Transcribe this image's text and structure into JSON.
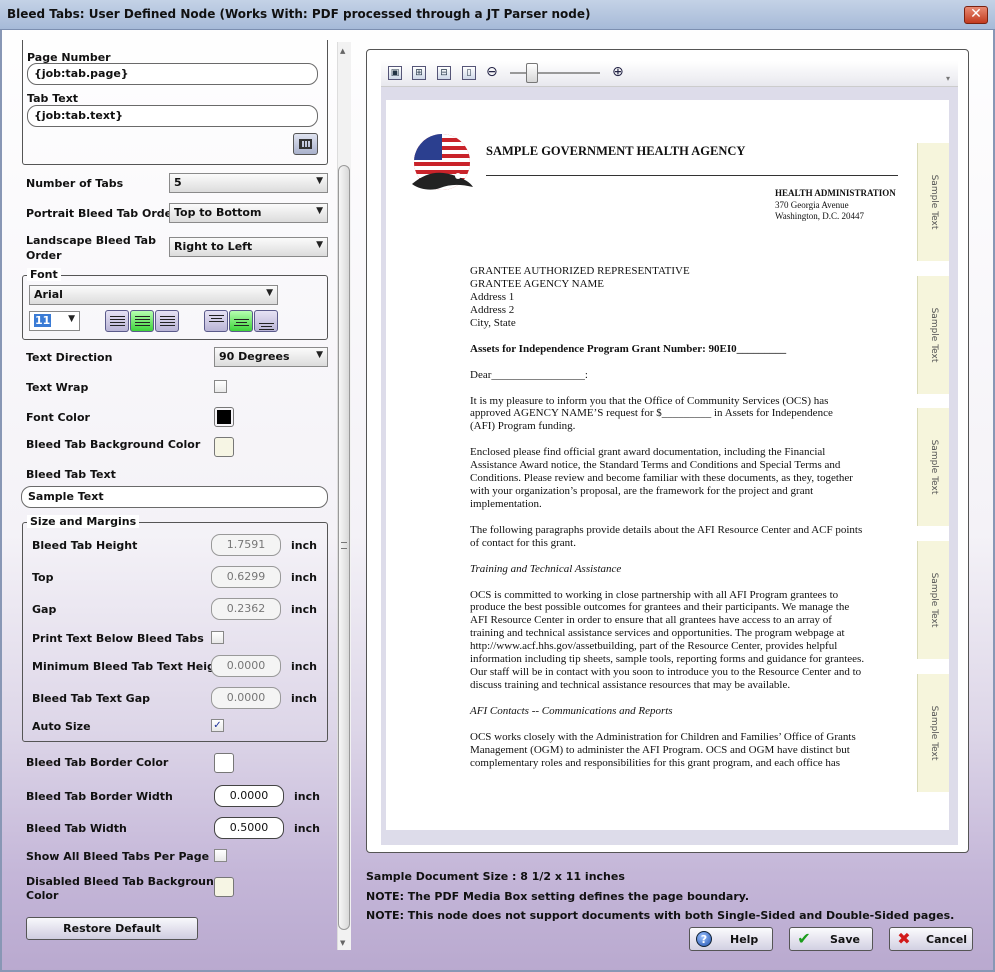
{
  "window": {
    "title": "Bleed Tabs: User Defined Node (Works With: PDF processed through a JT Parser node)",
    "close_label": "✕"
  },
  "form": {
    "page_number": {
      "label": "Page Number",
      "value": "{job:tab.page}"
    },
    "tab_text": {
      "label": "Tab Text",
      "value": "{job:tab.text}"
    },
    "number_of_tabs": {
      "label": "Number of Tabs",
      "value": "5"
    },
    "portrait_order": {
      "label": "Portrait Bleed Tab Order",
      "value": "Top to Bottom"
    },
    "landscape_order": {
      "label_line1": "Landscape Bleed Tab",
      "label_line2": "Order",
      "value": "Right to Left"
    },
    "font": {
      "group_title": "Font",
      "family": "Arial",
      "size": "11"
    },
    "text_direction": {
      "label": "Text Direction",
      "value": "90 Degrees"
    },
    "text_wrap": {
      "label": "Text Wrap",
      "checked": false
    },
    "font_color": {
      "label": "Font Color",
      "color": "#000000"
    },
    "tab_bg_color": {
      "label": "Bleed Tab Background Color",
      "color": "#f6f5e4"
    },
    "bleed_tab_text": {
      "label": "Bleed Tab Text",
      "value": "Sample Text"
    },
    "size_margins": {
      "group_title": "Size and Margins",
      "height": {
        "label": "Bleed Tab Height",
        "value": "1.7591",
        "unit": "inch"
      },
      "top": {
        "label": "Top",
        "value": "0.6299",
        "unit": "inch"
      },
      "gap": {
        "label": "Gap",
        "value": "0.2362",
        "unit": "inch"
      },
      "print_below": {
        "label": "Print Text Below Bleed Tabs",
        "checked": false
      },
      "min_text_height": {
        "label": "Minimum Bleed Tab Text Height",
        "value": "0.0000",
        "unit": "inch"
      },
      "text_gap": {
        "label": "Bleed Tab Text Gap",
        "value": "0.0000",
        "unit": "inch"
      },
      "auto_size": {
        "label": "Auto Size",
        "checked": true
      }
    },
    "border_color": {
      "label": "Bleed Tab Border Color",
      "color": "#ffffff"
    },
    "border_width": {
      "label": "Bleed Tab Border Width",
      "value": "0.0000",
      "unit": "inch"
    },
    "tab_width": {
      "label": "Bleed Tab Width",
      "value": "0.5000",
      "unit": "inch"
    },
    "show_all": {
      "label": "Show All Bleed Tabs Per Page",
      "checked": false
    },
    "disabled_bg": {
      "label_line1": "Disabled Bleed Tab Background",
      "label_line2": "Color",
      "color": "#f6f5e4"
    },
    "restore_label": "Restore Default"
  },
  "preview": {
    "tab_label": "Sample Text",
    "doc": {
      "agency": "SAMPLE GOVERNMENT HEALTH AGENCY",
      "admin": "HEALTH ADMINISTRATION",
      "street": "370 Georgia Avenue",
      "city": "Washington, D.C. 20447",
      "addr": [
        "GRANTEE AUTHORIZED REPRESENTATIVE",
        "GRANTEE AGENCY NAME",
        "Address 1",
        "Address 2",
        "City, State"
      ],
      "subject": "Assets for Independence Program Grant Number:  90EI0_________",
      "dear": "Dear_________________:",
      "p1": [
        "It is my pleasure to inform you that the Office of Community Services (OCS) has",
        "approved AGENCY NAME’S  request for $_________ in Assets for Independence",
        "(AFI) Program funding."
      ],
      "p2": [
        "Enclosed please find official grant award documentation, including the Financial",
        "Assistance Award notice, the Standard Terms and Conditions and Special Terms and",
        "Conditions.  Please review and become familiar with these documents, as they, together",
        "with your organization’s proposal, are the framework for the project and grant",
        "implementation."
      ],
      "p3": [
        "The following paragraphs provide details about the AFI Resource Center and ACF points",
        "of contact for this grant."
      ],
      "h1": "Training and Technical Assistance",
      "p4": [
        "OCS is committed to working in close partnership with all AFI Program grantees to",
        "produce the best possible outcomes for grantees and their participants.  We manage the",
        "AFI Resource Center in order to ensure that all grantees have access to an array of",
        "training and technical assistance services and opportunities.   The program webpage at",
        "http://www.acf.hhs.gov/assetbuilding, part of the Resource Center, provides helpful",
        "information including tip sheets, sample tools, reporting forms and guidance for grantees.",
        "Our staff will be in contact with you soon to introduce you to the Resource Center and to",
        "discuss training and technical assistance resources that may be available."
      ],
      "h2": "AFI Contacts -- Communications and Reports",
      "p5": [
        "OCS works closely with the Administration for Children and Families’ Office of Grants",
        "Management (OGM) to administer the AFI Program.  OCS and OGM have distinct but",
        "complementary roles and responsibilities for this grant program, and each office has"
      ]
    }
  },
  "notes": {
    "size": "Sample Document Size : 8 1/2 x 11 inches",
    "media_box": "NOTE: The PDF Media Box setting defines the page boundary.",
    "sided": "NOTE: This node does not support documents with both Single-Sided and Double-Sided pages."
  },
  "buttons": {
    "help": "Help",
    "save": "Save",
    "cancel": "Cancel"
  }
}
